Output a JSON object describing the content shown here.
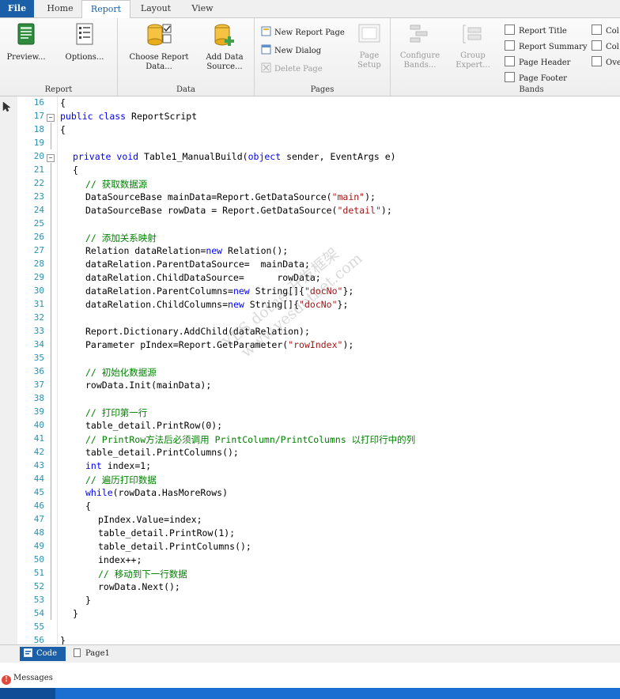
{
  "tabs": [
    "File",
    "Home",
    "Report",
    "Layout",
    "View"
  ],
  "ribbon": {
    "report_group": {
      "label": "Report",
      "preview": "Preview...",
      "options": "Options..."
    },
    "data_group": {
      "label": "Data",
      "choose_data_1": "Choose Report",
      "choose_data_2": "Data...",
      "add_source_1": "Add Data",
      "add_source_2": "Source..."
    },
    "pages_group": {
      "label": "Pages",
      "new_page": "New Report Page",
      "new_dialog": "New Dialog",
      "delete_page": "Delete Page",
      "page_setup_1": "Page",
      "page_setup_2": "Setup"
    },
    "bands_group": {
      "label": "Bands",
      "configure_1": "Configure",
      "configure_2": "Bands...",
      "group_1": "Group",
      "group_2": "Expert...",
      "report_title": "Report Title",
      "report_summary": "Report Summary",
      "page_header": "Page Header",
      "page_footer": "Page Footer",
      "col1": "Col",
      "col2": "Col",
      "ove": "Ove"
    }
  },
  "code": {
    "lines": [
      {
        "n": "16",
        "ind": 0,
        "t": [
          {
            "c": "{",
            "k": "p"
          }
        ]
      },
      {
        "n": "17",
        "ind": 0,
        "t": [
          {
            "c": "public",
            "k": "kw"
          },
          {
            "c": " "
          },
          {
            "c": "class",
            "k": "kw"
          },
          {
            "c": " ReportScript"
          }
        ]
      },
      {
        "n": "18",
        "ind": 0,
        "t": [
          {
            "c": "{",
            "k": "p"
          }
        ]
      },
      {
        "n": "19",
        "ind": 0,
        "t": []
      },
      {
        "n": "20",
        "ind": 1,
        "t": [
          {
            "c": "private",
            "k": "kw"
          },
          {
            "c": " "
          },
          {
            "c": "void",
            "k": "kw"
          },
          {
            "c": " Table1_ManualBuild("
          },
          {
            "c": "object",
            "k": "kw"
          },
          {
            "c": " sender, EventArgs e)"
          }
        ]
      },
      {
        "n": "21",
        "ind": 1,
        "t": [
          {
            "c": "{",
            "k": "p"
          }
        ]
      },
      {
        "n": "22",
        "ind": 2,
        "t": [
          {
            "c": "// 获取数据源",
            "k": "cm"
          }
        ]
      },
      {
        "n": "23",
        "ind": 2,
        "t": [
          {
            "c": "DataSourceBase mainData=Report.GetDataSource("
          },
          {
            "c": "\"main\"",
            "k": "str"
          },
          {
            "c": ");"
          }
        ]
      },
      {
        "n": "24",
        "ind": 2,
        "t": [
          {
            "c": "DataSourceBase rowData = Report.GetDataSource("
          },
          {
            "c": "\"detail\"",
            "k": "str"
          },
          {
            "c": ");"
          }
        ]
      },
      {
        "n": "25",
        "ind": 0,
        "t": []
      },
      {
        "n": "26",
        "ind": 2,
        "t": [
          {
            "c": "// 添加关系映射",
            "k": "cm"
          }
        ]
      },
      {
        "n": "27",
        "ind": 2,
        "t": [
          {
            "c": "Relation dataRelation="
          },
          {
            "c": "new",
            "k": "kw"
          },
          {
            "c": " Relation();"
          }
        ]
      },
      {
        "n": "28",
        "ind": 2,
        "t": [
          {
            "c": "dataRelation.ParentDataSource=  mainData;"
          }
        ]
      },
      {
        "n": "29",
        "ind": 2,
        "t": [
          {
            "c": "dataRelation.ChildDataSource=      rowData;"
          }
        ]
      },
      {
        "n": "30",
        "ind": 2,
        "t": [
          {
            "c": "dataRelation.ParentColumns="
          },
          {
            "c": "new",
            "k": "kw"
          },
          {
            "c": " String[]{"
          },
          {
            "c": "\"docNo\"",
            "k": "str"
          },
          {
            "c": "};"
          }
        ]
      },
      {
        "n": "31",
        "ind": 2,
        "t": [
          {
            "c": "dataRelation.ChildColumns="
          },
          {
            "c": "new",
            "k": "kw"
          },
          {
            "c": " String[]{"
          },
          {
            "c": "\"docNo\"",
            "k": "str"
          },
          {
            "c": "};"
          }
        ]
      },
      {
        "n": "32",
        "ind": 0,
        "t": []
      },
      {
        "n": "33",
        "ind": 2,
        "t": [
          {
            "c": "Report.Dictionary.AddChild(dataRelation);"
          }
        ]
      },
      {
        "n": "34",
        "ind": 2,
        "t": [
          {
            "c": "Parameter pIndex=Report.GetParameter("
          },
          {
            "c": "\"rowIndex\"",
            "k": "str"
          },
          {
            "c": ");"
          }
        ]
      },
      {
        "n": "35",
        "ind": 0,
        "t": []
      },
      {
        "n": "36",
        "ind": 2,
        "t": [
          {
            "c": "// 初始化数据源",
            "k": "cm"
          }
        ]
      },
      {
        "n": "37",
        "ind": 2,
        "t": [
          {
            "c": "rowData.Init(mainData);"
          }
        ]
      },
      {
        "n": "38",
        "ind": 0,
        "t": []
      },
      {
        "n": "39",
        "ind": 2,
        "t": [
          {
            "c": "// 打印第一行",
            "k": "cm"
          }
        ]
      },
      {
        "n": "40",
        "ind": 2,
        "t": [
          {
            "c": "table_detail.PrintRow(0);"
          }
        ]
      },
      {
        "n": "41",
        "ind": 2,
        "t": [
          {
            "c": "// PrintRow方法后必须调用 PrintColumn/PrintColumns 以打印行中的列",
            "k": "cm"
          }
        ]
      },
      {
        "n": "42",
        "ind": 2,
        "t": [
          {
            "c": "table_detail.PrintColumns();"
          }
        ]
      },
      {
        "n": "43",
        "ind": 2,
        "t": [
          {
            "c": "int",
            "k": "kw"
          },
          {
            "c": " index=1;"
          }
        ]
      },
      {
        "n": "44",
        "ind": 2,
        "t": [
          {
            "c": "// 遍历打印数据",
            "k": "cm"
          }
        ]
      },
      {
        "n": "45",
        "ind": 2,
        "t": [
          {
            "c": "while",
            "k": "kw"
          },
          {
            "c": "(rowData.HasMoreRows)"
          }
        ]
      },
      {
        "n": "46",
        "ind": 2,
        "t": [
          {
            "c": "{",
            "k": "p"
          }
        ]
      },
      {
        "n": "47",
        "ind": 3,
        "t": [
          {
            "c": "pIndex.Value=index;"
          }
        ]
      },
      {
        "n": "48",
        "ind": 3,
        "t": [
          {
            "c": "table_detail.PrintRow(1);"
          }
        ]
      },
      {
        "n": "49",
        "ind": 3,
        "t": [
          {
            "c": "table_detail.PrintColumns();"
          }
        ]
      },
      {
        "n": "50",
        "ind": 3,
        "t": [
          {
            "c": "index++;"
          }
        ]
      },
      {
        "n": "51",
        "ind": 3,
        "t": [
          {
            "c": "// 移动到下一行数据",
            "k": "cm"
          }
        ]
      },
      {
        "n": "52",
        "ind": 3,
        "t": [
          {
            "c": "rowData.Next();"
          }
        ]
      },
      {
        "n": "53",
        "ind": 2,
        "t": [
          {
            "c": "}",
            "k": "p"
          }
        ]
      },
      {
        "n": "54",
        "ind": 1,
        "t": [
          {
            "c": "}",
            "k": "p"
          }
        ]
      },
      {
        "n": "55",
        "ind": 0,
        "t": []
      },
      {
        "n": "56",
        "ind": 0,
        "t": [
          {
            "c": "}",
            "k": "p"
          }
        ]
      }
    ]
  },
  "watermark": {
    "line1": "YES  dotnet开发框架",
    "line2": "www.yesdotnet.com"
  },
  "bottom_tabs": {
    "code": "Code",
    "page1": "Page1"
  },
  "messages": "Messages",
  "colors": {
    "keyword": "#0000ff",
    "string": "#a31515",
    "comment": "#008000",
    "line_number": "#2b91af",
    "accent": "#1a5fa8"
  }
}
